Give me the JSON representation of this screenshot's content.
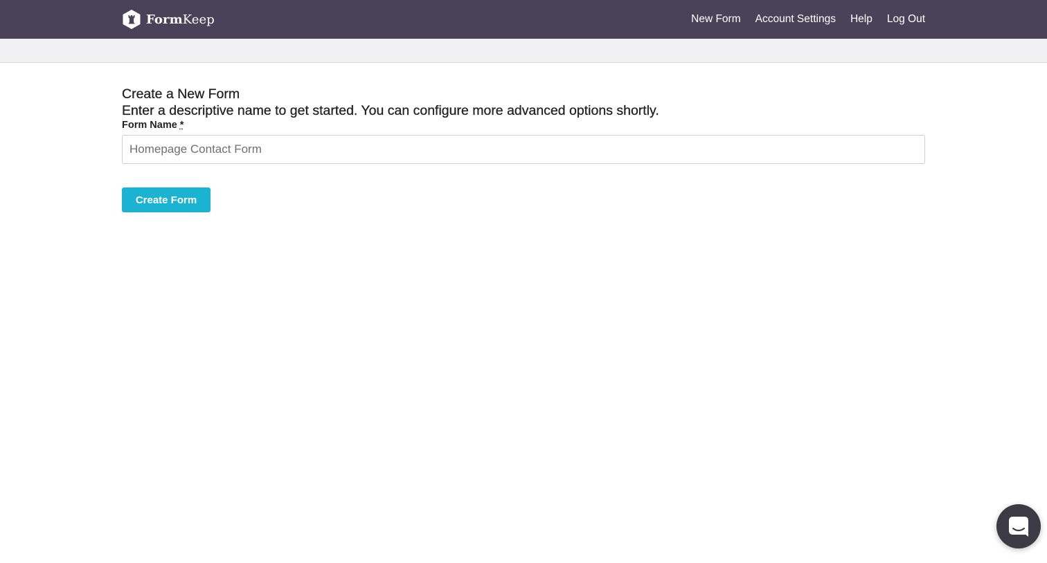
{
  "brand": {
    "name_bold": "Form",
    "name_regular": "Keep",
    "logo_icon": "hexagon-rook-logo-icon"
  },
  "nav": {
    "items": [
      {
        "label": "New Form"
      },
      {
        "label": "Account Settings"
      },
      {
        "label": "Help"
      },
      {
        "label": "Log Out"
      }
    ]
  },
  "main": {
    "title": "Create a New Form",
    "subtitle": "Enter a descriptive name to get started. You can configure more advanced options shortly.",
    "form_name": {
      "label": "Form Name",
      "required_marker": "*",
      "value": "",
      "placeholder": "Homepage Contact Form"
    },
    "submit_label": "Create Form"
  },
  "chat": {
    "icon": "chat-bubble-icon"
  },
  "colors": {
    "topbar": "#4a4258",
    "subbar": "#f1f1f3",
    "accent": "#1bb3d1",
    "chat_launcher": "#3b3a45"
  }
}
